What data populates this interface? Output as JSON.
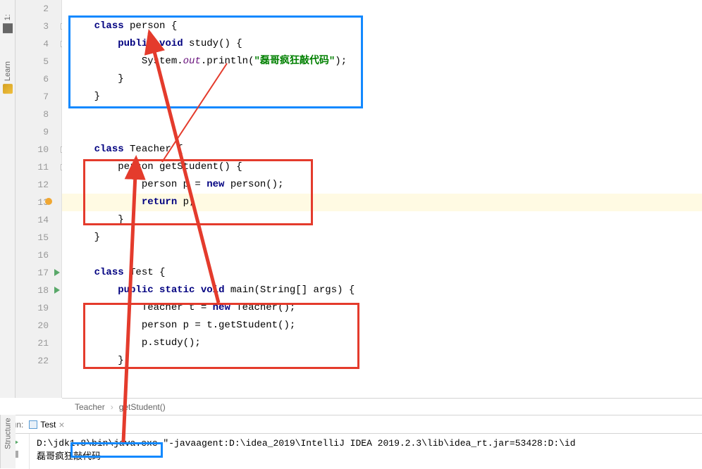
{
  "toolbar": {
    "project_label": "1:",
    "learn_label": "Learn"
  },
  "structure_label": "Structure",
  "gutter": {
    "lines": [
      "2",
      "3",
      "4",
      "5",
      "6",
      "7",
      "8",
      "9",
      "10",
      "11",
      "12",
      "13",
      "14",
      "15",
      "16",
      "17",
      "18",
      "19",
      "20",
      "21",
      "22"
    ]
  },
  "code": {
    "l2": "",
    "l3_kw": "class",
    "l3_rest": " person {",
    "l4_kw1": "public",
    "l4_mid": " ",
    "l4_kw2": "void",
    "l4_rest": " study() {",
    "l5_pre": "            System.",
    "l5_field": "out",
    "l5_mid": ".println(",
    "l5_str": "\"磊哥疯狂敲代码\"",
    "l5_post": ");",
    "l6": "        }",
    "l7": "    }",
    "l8": "",
    "l9": "",
    "l10_kw": "class",
    "l10_rest": " Teacher {",
    "l11": "        person getStudent() {",
    "l12_pre": "            person p = ",
    "l12_kw": "new",
    "l12_rest": " person();",
    "l13_kw": "return",
    "l13_rest": " p;",
    "l14": "        }",
    "l15": "    }",
    "l16": "",
    "l17_kw": "class",
    "l17_rest": " Test {",
    "l18_kw1": "public",
    "l18_kw2": "static",
    "l18_kw3": "void",
    "l18_rest": " main(String[] args) {",
    "l19_pre": "            Teacher t = ",
    "l19_kw": "new",
    "l19_rest": " Teacher();",
    "l20": "            person p = t.getStudent();",
    "l21": "            p.study();",
    "l22": "        }"
  },
  "breadcrumb": {
    "item1": "Teacher",
    "item2": "getStudent()"
  },
  "run": {
    "label": "Run:",
    "tab_name": "Test",
    "console_line1": "D:\\jdk1.8\\bin\\java.exe \"-javaagent:D:\\idea_2019\\IntelliJ IDEA 2019.2.3\\lib\\idea_rt.jar=53428:D:\\id",
    "console_line2": "磊哥疯狂敲代码"
  }
}
